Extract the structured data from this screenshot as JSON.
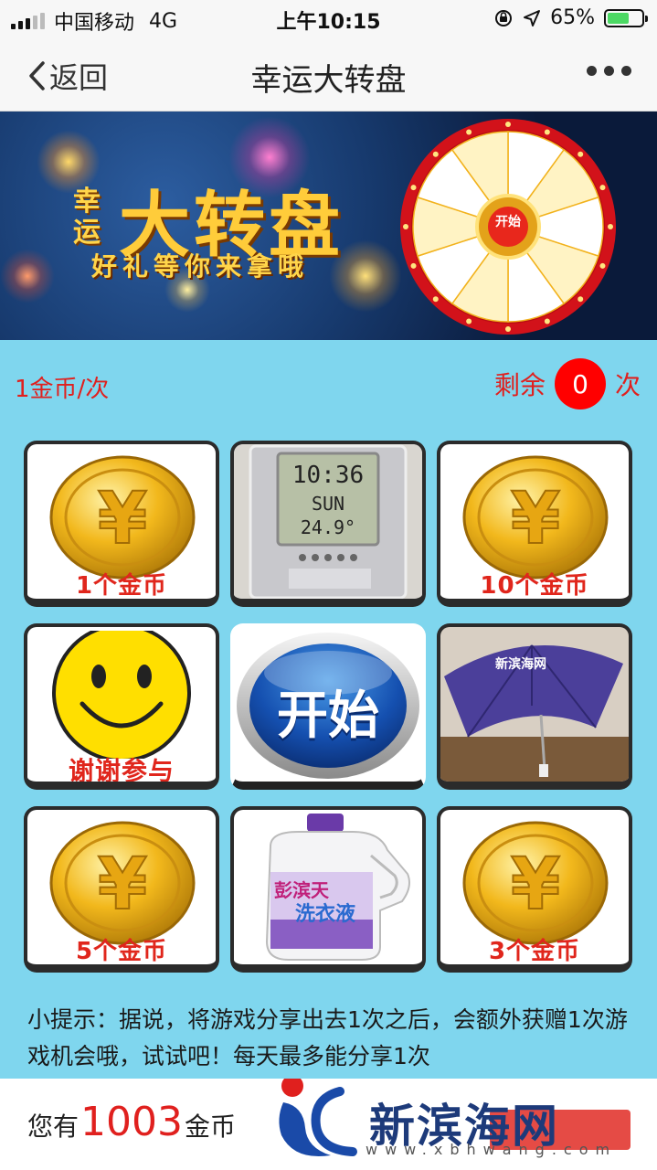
{
  "status_bar": {
    "carrier": "中国移动",
    "network": "4G",
    "time": "上午10:15",
    "battery_percent": "65%",
    "battery_level": 0.65
  },
  "nav": {
    "back_label": "返回",
    "title": "幸运大转盘"
  },
  "banner": {
    "lucky": "幸运",
    "title": "大转盘",
    "subtitle": "好礼等你来拿哦",
    "wheel_button": "开始"
  },
  "info": {
    "cost": "1金币/次",
    "remaining_label": "剩余",
    "remaining_count": "0",
    "remaining_unit": "次"
  },
  "grid": {
    "coin_1": "1个金币",
    "coin_10": "10个金币",
    "thanks": "谢谢参与",
    "start": "开始",
    "coin_5": "5个金币",
    "coin_3": "3个金币",
    "clock_time": "10:36",
    "clock_day": "SUN",
    "clock_temp": "24.9°",
    "umbrella_brand": "新滨海网",
    "detergent_brand": "彭滨天",
    "detergent_name": "洗衣液"
  },
  "tip": "小提示：据说，将游戏分享出去1次之后，会额外获赠1次游戏机会哦，试试吧！每天最多能分享1次",
  "footer": {
    "coins_prefix": "您有",
    "coins_value": "1003",
    "coins_suffix": "金币",
    "logo_text": "新滨海网",
    "logo_url": "www.xbhwang.com"
  },
  "colors": {
    "background": "#7fd6ee",
    "accent_red": "#e0201e",
    "coin_gold": "#f2b81c"
  }
}
